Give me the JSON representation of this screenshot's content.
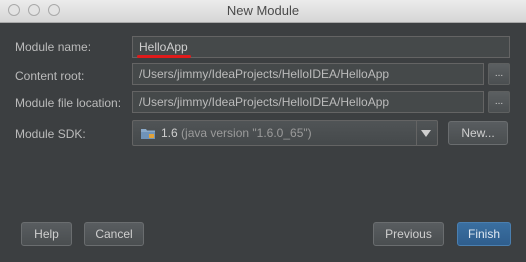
{
  "window": {
    "title": "New Module"
  },
  "form": {
    "module_name_label": "Module name:",
    "module_name_value": "HelloApp",
    "content_root_label": "Content root:",
    "content_root_value": "/Users/jimmy/IdeaProjects/HelloIDEA/HelloApp",
    "module_file_label": "Module file location:",
    "module_file_value": "/Users/jimmy/IdeaProjects/HelloIDEA/HelloApp",
    "browse_label": "...",
    "sdk_label": "Module SDK:",
    "sdk_version": "1.6",
    "sdk_info": "(java version \"1.6.0_65\")",
    "new_label": "New..."
  },
  "buttons": {
    "help": "Help",
    "cancel": "Cancel",
    "previous": "Previous",
    "finish": "Finish"
  },
  "colors": {
    "background": "#3c3f41",
    "accent": "#2f5e8d",
    "highlight": "#e01b1b"
  }
}
